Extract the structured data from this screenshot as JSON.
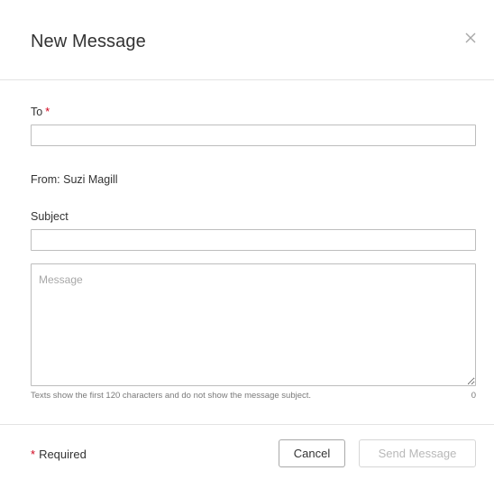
{
  "dialog": {
    "title": "New Message",
    "close_icon": "close-icon"
  },
  "form": {
    "to_label": "To",
    "to_required_marker": "*",
    "to_value": "",
    "from_text": "From: Suzi Magill",
    "subject_label": "Subject",
    "subject_value": "",
    "message_placeholder": "Message",
    "message_value": "",
    "hint": "Texts show the first 120 characters and do not show the message subject.",
    "char_count": "0"
  },
  "footer": {
    "required_marker": "*",
    "required_label": "Required",
    "cancel_label": "Cancel",
    "send_label": "Send Message"
  },
  "colors": {
    "required": "#d0021b",
    "border": "#bdbdbd",
    "disabled_text": "#b8b8b8"
  }
}
